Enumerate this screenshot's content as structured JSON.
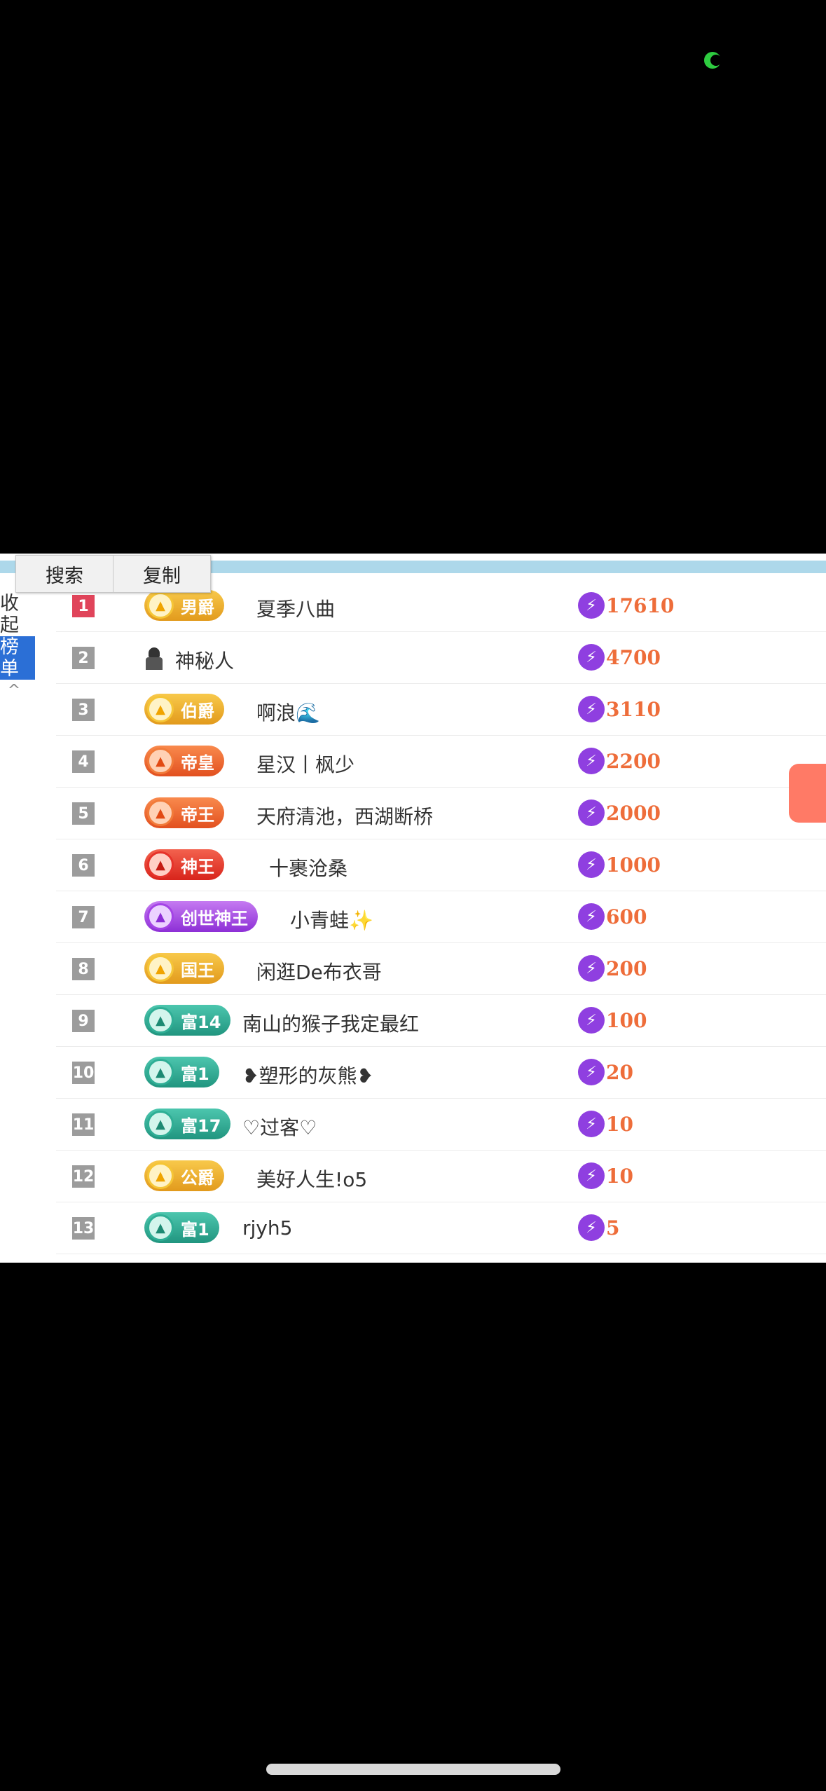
{
  "context_menu": {
    "search_label": "搜索",
    "copy_label": "复制"
  },
  "side": {
    "collapse_label": "收起",
    "board_label": "榜单",
    "caret": "^"
  },
  "score_icon": "lightning-icon",
  "accent_colors": {
    "rank_top": "#e0445a",
    "score_text": "#ee6d3a",
    "bolt": "#8f3fe0"
  },
  "rows": [
    {
      "rank": "1",
      "badge": "男爵",
      "badge_style": "gold",
      "name": "夏季八曲",
      "score": "17610"
    },
    {
      "rank": "2",
      "badge": "",
      "badge_style": "mystery",
      "name": "神秘人",
      "score": "4700"
    },
    {
      "rank": "3",
      "badge": "伯爵",
      "badge_style": "gold",
      "name": "啊浪🌊",
      "score": "3110"
    },
    {
      "rank": "4",
      "badge": "帝皇",
      "badge_style": "orange",
      "name": "星汉丨枫少",
      "score": "2200"
    },
    {
      "rank": "5",
      "badge": "帝王",
      "badge_style": "orange",
      "name": "天府清池，西湖断桥",
      "score": "2000"
    },
    {
      "rank": "6",
      "badge": "神王",
      "badge_style": "red",
      "name": "十裹沧桑",
      "score": "1000"
    },
    {
      "rank": "7",
      "badge": "创世神王",
      "badge_style": "purple",
      "name": "小青蛙✨",
      "score": "600"
    },
    {
      "rank": "8",
      "badge": "国王",
      "badge_style": "gold",
      "name": "闲逛De布衣哥",
      "score": "200"
    },
    {
      "rank": "9",
      "badge": "富14",
      "badge_style": "teal",
      "name": "南山的猴子我定最红",
      "score": "100"
    },
    {
      "rank": "10",
      "badge": "富1",
      "badge_style": "teal",
      "name": "❥塑形的灰熊❥",
      "score": "20"
    },
    {
      "rank": "11",
      "badge": "富17",
      "badge_style": "teal",
      "name": "♡过客♡",
      "score": "10"
    },
    {
      "rank": "12",
      "badge": "公爵",
      "badge_style": "gold",
      "name": "美好人生!o5",
      "score": "10"
    },
    {
      "rank": "13",
      "badge": "富1",
      "badge_style": "teal",
      "name": "rjyh5",
      "score": "5"
    }
  ]
}
